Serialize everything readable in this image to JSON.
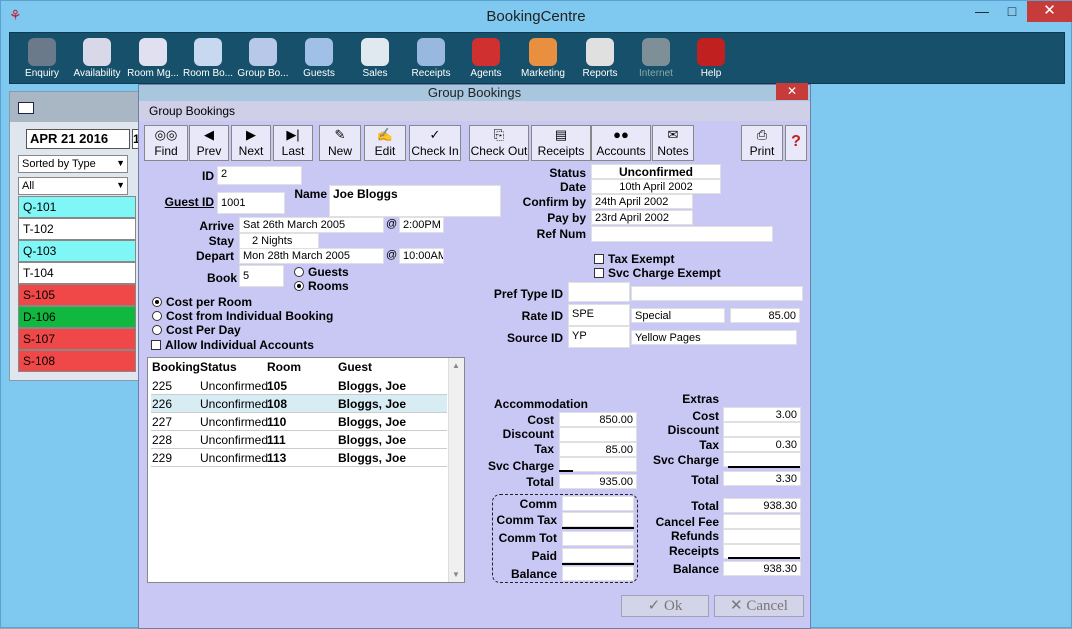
{
  "app": {
    "title": "BookingCentre"
  },
  "window_controls": {
    "minimize": "—",
    "maximize": "□",
    "close": "✕"
  },
  "toolbar": [
    {
      "label": "Enquiry",
      "icon": "binoculars-icon",
      "color": "#6a7a8a"
    },
    {
      "label": "Availability",
      "icon": "calendar-icon",
      "color": "#d8d8e8"
    },
    {
      "label": "Room Mg...",
      "icon": "room-calendar-icon",
      "color": "#e0e0f0"
    },
    {
      "label": "Room Bo...",
      "icon": "person-booking-icon",
      "color": "#c8d8f0"
    },
    {
      "label": "Group Bo...",
      "icon": "group-booking-icon",
      "color": "#b8c8e8"
    },
    {
      "label": "Guests",
      "icon": "guests-icon",
      "color": "#a0c0e8"
    },
    {
      "label": "Sales",
      "icon": "sales-icon",
      "color": "#e0e8f0"
    },
    {
      "label": "Receipts",
      "icon": "receipts-icon",
      "color": "#98b8e0"
    },
    {
      "label": "Agents",
      "icon": "agents-icon",
      "color": "#d03030"
    },
    {
      "label": "Marketing",
      "icon": "marketing-icon",
      "color": "#e89040"
    },
    {
      "label": "Reports",
      "icon": "reports-icon",
      "color": "#e0e0e0"
    },
    {
      "label": "Internet",
      "icon": "internet-globe-icon",
      "color": "#7f8f98"
    },
    {
      "label": "Help",
      "icon": "help-icon",
      "color": "#c02020"
    }
  ],
  "left_panel": {
    "date": "APR 21 2016",
    "date_suffix": "1",
    "sort": "Sorted by Type",
    "filter": "All",
    "rooms": [
      {
        "label": "Q-101",
        "color": "#7ff7f7"
      },
      {
        "label": "T-102",
        "color": "#ffffff"
      },
      {
        "label": "Q-103",
        "color": "#7ff7f7"
      },
      {
        "label": "T-104",
        "color": "#ffffff"
      },
      {
        "label": "S-105",
        "color": "#f04848"
      },
      {
        "label": "D-106",
        "color": "#10b840"
      },
      {
        "label": "S-107",
        "color": "#f04848"
      },
      {
        "label": "S-108",
        "color": "#f04848"
      }
    ]
  },
  "dialog": {
    "title": "Group Bookings",
    "close": "✕",
    "subtitle": "Group Bookings",
    "buttons": [
      {
        "label": "Find",
        "icon": "◎◎"
      },
      {
        "label": "Prev",
        "icon": "◀"
      },
      {
        "label": "Next",
        "icon": "▶"
      },
      {
        "label": "Last",
        "icon": "▶|"
      },
      {
        "label": "New",
        "icon": "✎"
      },
      {
        "label": "Edit",
        "icon": "✍"
      },
      {
        "label": "Check In",
        "icon": "✓"
      },
      {
        "label": "Check Out",
        "icon": "⎘"
      },
      {
        "label": "Receipts",
        "icon": "▤"
      },
      {
        "label": "Accounts",
        "icon": "●●"
      },
      {
        "label": "Notes",
        "icon": "✉"
      },
      {
        "label": "Print",
        "icon": "⎙"
      },
      {
        "label": "",
        "icon": "?"
      }
    ],
    "fields": {
      "id_label": "ID",
      "id": "2",
      "guest_id_label": "Guest ID",
      "guest_id": "1001",
      "name_label": "Name",
      "name": "Joe Bloggs",
      "arrive_label": "Arrive",
      "arrive": "Sat 26th March 2005",
      "arrive_at": "@",
      "arrive_time": "2:00PM",
      "stay_label": "Stay",
      "stay": "2 Nights",
      "depart_label": "Depart",
      "depart": "Mon 28th March 2005",
      "depart_at": "@",
      "depart_time": "10:00AM",
      "book_label": "Book",
      "book": "5",
      "guests_opt": "Guests",
      "rooms_opt": "Rooms",
      "status_label": "Status",
      "status": "Unconfirmed",
      "date_label": "Date",
      "date": "10th April 2002",
      "confirm_label": "Confirm by",
      "confirm": "24th April 2002",
      "pay_label": "Pay by",
      "pay": "23rd April 2002",
      "ref_label": "Ref Num",
      "ref": "",
      "tax_exempt": "Tax Exempt",
      "svc_exempt": "Svc Charge Exempt",
      "pref_label": "Pref Type ID",
      "pref": "",
      "rate_label": "Rate ID",
      "rate_id": "SPE",
      "rate_name": "Special",
      "rate_amount": "85.00",
      "source_label": "Source ID",
      "source_id": "YP",
      "source_name": "Yellow Pages",
      "cost_per_room": "Cost per Room",
      "cost_individual": "Cost from Individual Booking",
      "cost_per_day": "Cost Per Day",
      "allow_individual": "Allow Individual Accounts"
    },
    "grid": {
      "headers": [
        "Booking",
        "Status",
        "Room",
        "Guest"
      ],
      "rows": [
        [
          "225",
          "Unconfirmed",
          "105",
          "Bloggs, Joe"
        ],
        [
          "226",
          "Unconfirmed",
          "108",
          "Bloggs, Joe"
        ],
        [
          "227",
          "Unconfirmed",
          "110",
          "Bloggs, Joe"
        ],
        [
          "228",
          "Unconfirmed",
          "111",
          "Bloggs, Joe"
        ],
        [
          "229",
          "Unconfirmed",
          "113",
          "Bloggs, Joe"
        ]
      ]
    },
    "accommodation": {
      "title": "Accommodation",
      "cost_label": "Cost",
      "cost": "850.00",
      "discount_label": "Discount",
      "discount": "",
      "tax_label": "Tax",
      "tax": "85.00",
      "svc_label": "Svc Charge",
      "svc": "",
      "total_label": "Total",
      "total": "935.00"
    },
    "extras": {
      "title": "Extras",
      "cost_label": "Cost",
      "cost": "3.00",
      "discount_label": "Discount",
      "discount": "",
      "tax_label": "Tax",
      "tax": "0.30",
      "svc_label": "Svc Charge",
      "svc": "",
      "total_label": "Total",
      "total": "3.30"
    },
    "commission": {
      "comm_label": "Comm",
      "comm_tax_label": "Comm Tax",
      "comm_tot_label": "Comm Tot",
      "paid_label": "Paid",
      "balance_label": "Balance"
    },
    "summary": {
      "total_label": "Total",
      "total": "938.30",
      "cancel_fee_label": "Cancel Fee",
      "cancel_fee": "",
      "refunds_label": "Refunds",
      "refunds": "",
      "receipts_label": "Receipts",
      "receipts": "",
      "balance_label": "Balance",
      "balance": "938.30"
    },
    "ok": "✓  Ok",
    "cancel": "✕  Cancel"
  }
}
